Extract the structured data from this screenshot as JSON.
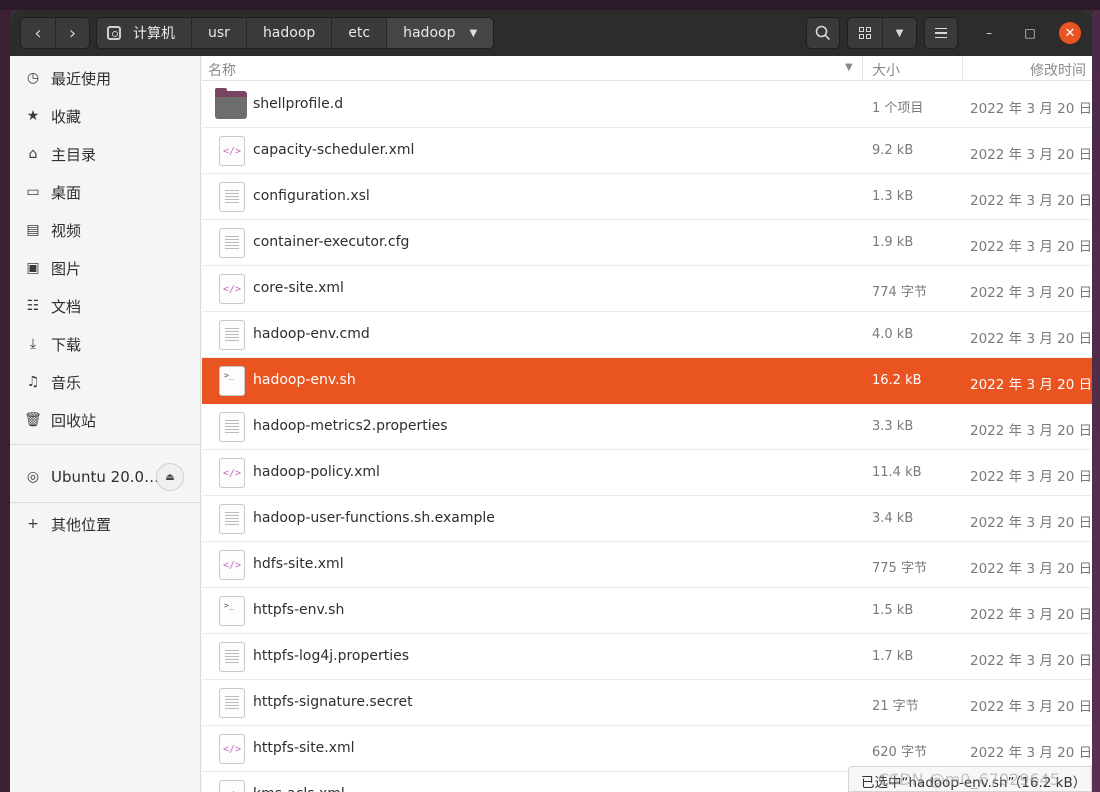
{
  "navigation": {
    "back_icon": "chevron-left-icon",
    "forward_icon": "chevron-right-icon"
  },
  "pathbar": {
    "crumbs": [
      "计算机",
      "usr",
      "hadoop",
      "etc",
      "hadoop"
    ]
  },
  "sidebar": {
    "items": [
      {
        "label": "最近使用",
        "icon": "clock-icon"
      },
      {
        "label": "收藏",
        "icon": "star-icon"
      },
      {
        "label": "主目录",
        "icon": "home-icon"
      },
      {
        "label": "桌面",
        "icon": "desktop-icon"
      },
      {
        "label": "视频",
        "icon": "film-icon"
      },
      {
        "label": "图片",
        "icon": "image-icon"
      },
      {
        "label": "文档",
        "icon": "document-icon"
      },
      {
        "label": "下载",
        "icon": "download-icon"
      },
      {
        "label": "音乐",
        "icon": "music-icon"
      },
      {
        "label": "回收站",
        "icon": "trash-icon"
      }
    ],
    "device": {
      "label": "Ubuntu 20.0…",
      "icon": "disc-icon"
    },
    "other": {
      "label": "其他位置",
      "icon": "plus-icon"
    }
  },
  "columns": {
    "name": "名称",
    "size": "大小",
    "modified": "修改时间"
  },
  "files": [
    {
      "name": "shellprofile.d",
      "size": "1 个项目",
      "modified": "2022 年 3 月 20 日",
      "type": "folder"
    },
    {
      "name": "capacity-scheduler.xml",
      "size": "9.2 kB",
      "modified": "2022 年 3 月 20 日",
      "type": "code"
    },
    {
      "name": "configuration.xsl",
      "size": "1.3 kB",
      "modified": "2022 年 3 月 20 日",
      "type": "text"
    },
    {
      "name": "container-executor.cfg",
      "size": "1.9 kB",
      "modified": "2022 年 3 月 20 日",
      "type": "text"
    },
    {
      "name": "core-site.xml",
      "size": "774 字节",
      "modified": "2022 年 3 月 20 日",
      "type": "code"
    },
    {
      "name": "hadoop-env.cmd",
      "size": "4.0 kB",
      "modified": "2022 年 3 月 20 日",
      "type": "text"
    },
    {
      "name": "hadoop-env.sh",
      "size": "16.2 kB",
      "modified": "2022 年 3 月 20 日",
      "type": "script",
      "selected": true
    },
    {
      "name": "hadoop-metrics2.properties",
      "size": "3.3 kB",
      "modified": "2022 年 3 月 20 日",
      "type": "text"
    },
    {
      "name": "hadoop-policy.xml",
      "size": "11.4 kB",
      "modified": "2022 年 3 月 20 日",
      "type": "code"
    },
    {
      "name": "hadoop-user-functions.sh.example",
      "size": "3.4 kB",
      "modified": "2022 年 3 月 20 日",
      "type": "text"
    },
    {
      "name": "hdfs-site.xml",
      "size": "775 字节",
      "modified": "2022 年 3 月 20 日",
      "type": "code"
    },
    {
      "name": "httpfs-env.sh",
      "size": "1.5 kB",
      "modified": "2022 年 3 月 20 日",
      "type": "script"
    },
    {
      "name": "httpfs-log4j.properties",
      "size": "1.7 kB",
      "modified": "2022 年 3 月 20 日",
      "type": "text"
    },
    {
      "name": "httpfs-signature.secret",
      "size": "21 字节",
      "modified": "2022 年 3 月 20 日",
      "type": "text"
    },
    {
      "name": "httpfs-site.xml",
      "size": "620 字节",
      "modified": "2022 年 3 月 20 日",
      "type": "code"
    },
    {
      "name": "kms-acls.xml",
      "size": "",
      "modified": "",
      "type": "code"
    }
  ],
  "status": "已选中“hadoop-env.sh”（16.2 kB）",
  "watermark": "CSDN @m0_67029645",
  "colors": {
    "accent": "#e95420",
    "headerbar": "#2c2c2c"
  }
}
